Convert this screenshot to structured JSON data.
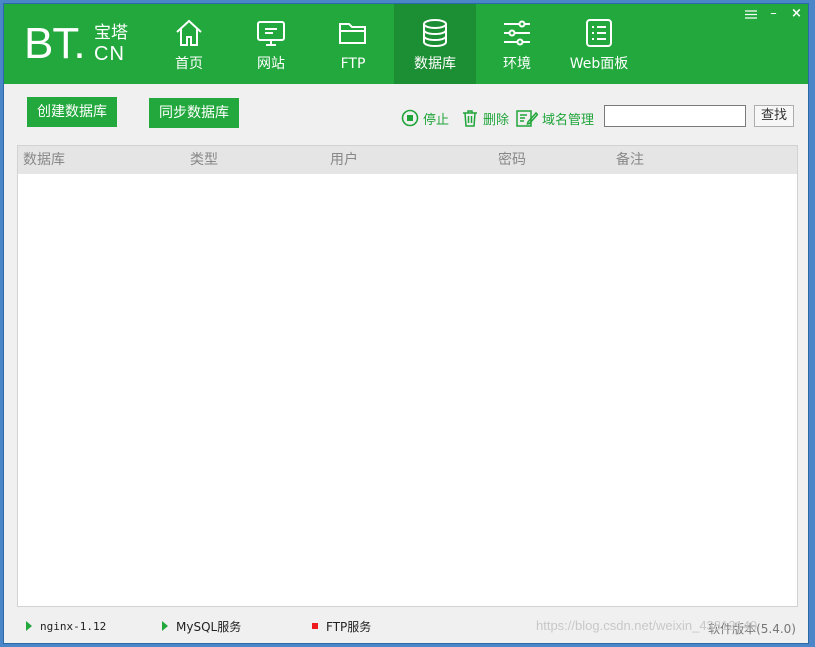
{
  "app": {
    "logo_main": "BT.",
    "logo_cn_top": "宝塔",
    "logo_cn_bottom": "CN"
  },
  "nav": {
    "items": [
      {
        "label": "首页",
        "icon": "home-icon"
      },
      {
        "label": "网站",
        "icon": "monitor-icon"
      },
      {
        "label": "FTP",
        "icon": "folder-icon"
      },
      {
        "label": "数据库",
        "icon": "database-icon",
        "active": true
      },
      {
        "label": "环境",
        "icon": "sliders-icon"
      },
      {
        "label": "Web面板",
        "icon": "list-panel-icon"
      }
    ]
  },
  "window_controls": {
    "minimize": "–",
    "close": "×"
  },
  "toolbar": {
    "create_db": "创建数据库",
    "sync_db": "同步数据库",
    "stop": "停止",
    "delete": "删除",
    "domain_manage": "域名管理",
    "search_value": "",
    "search_button": "查找"
  },
  "table": {
    "columns": [
      "数据库",
      "类型",
      "用户",
      "密码",
      "备注"
    ],
    "rows": []
  },
  "status": {
    "nginx": "nginx-1.12",
    "mysql": "MySQL服务",
    "ftp": "FTP服务",
    "version": "软件版本(5.4.0)",
    "watermark": "https://blog.csdn.net/weixin_43812140"
  },
  "colors": {
    "brand_green": "#22a83c",
    "active_nav": "#1c8e33",
    "stopped_red": "#ee1c1c"
  }
}
